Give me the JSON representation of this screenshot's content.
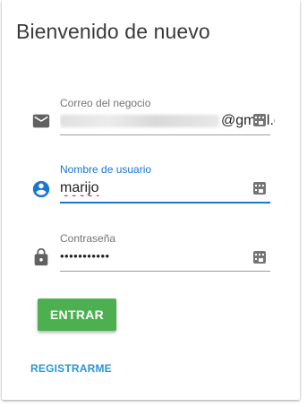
{
  "title": "Bienvenido de nuevo",
  "fields": {
    "email": {
      "label": "Correo del negocio",
      "value_suffix": "@gmail.c",
      "icon": "email-icon"
    },
    "username": {
      "label": "Nombre de usuario",
      "value": "marijo",
      "icon": "account-circle-icon"
    },
    "password": {
      "label": "Contraseña",
      "value": "•••••••••••",
      "icon": "lock-icon"
    }
  },
  "buttons": {
    "login": "ENTRAR",
    "register": "REGISTRARME"
  },
  "colors": {
    "accent": "#1976d2",
    "login_button": "#4caf50",
    "link": "#2a95d8"
  }
}
